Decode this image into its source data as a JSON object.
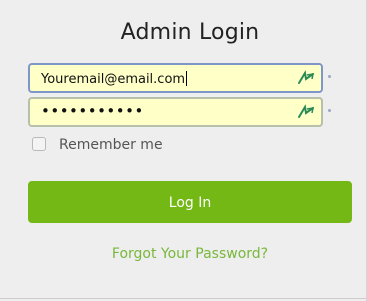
{
  "login": {
    "title": "Admin Login",
    "email_value": "Youremail@email.com",
    "password_masked": "•••••••••••",
    "remember_label": "Remember me",
    "remember_checked": false,
    "login_button_label": "Log In",
    "forgot_link": "Forgot Your Password?"
  },
  "icons": {
    "autofill": "password-manager-icon"
  },
  "colors": {
    "accent": "#74b816",
    "link": "#79b73a",
    "field_bg": "#ffffc8",
    "page_bg": "#eeeeee"
  }
}
